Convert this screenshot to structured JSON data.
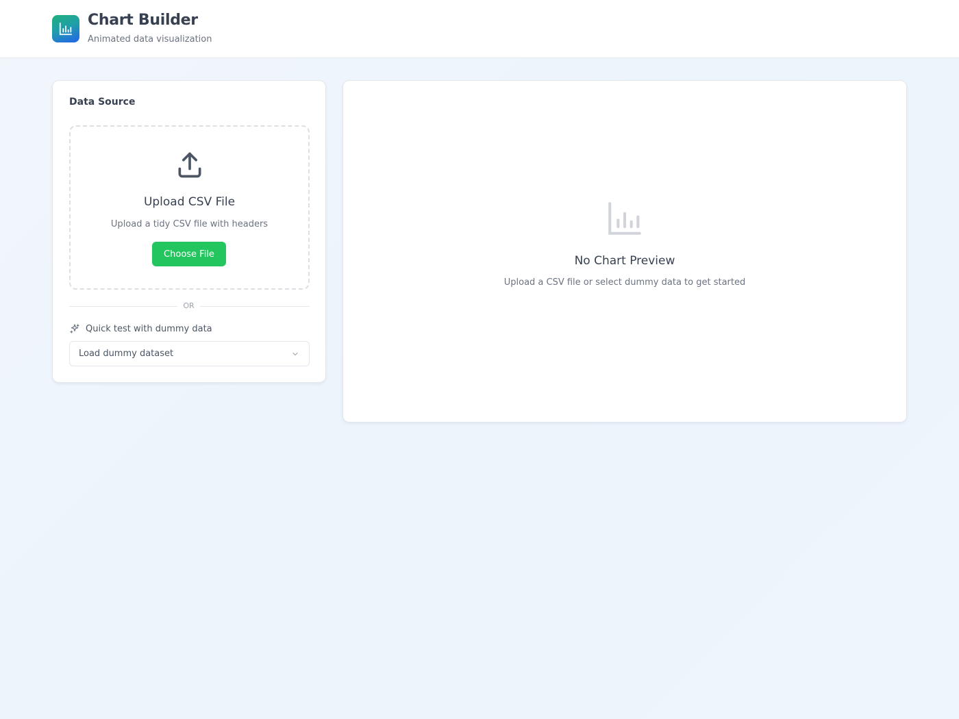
{
  "header": {
    "title": "Chart Builder",
    "subtitle": "Animated data visualization",
    "logo_icon": "bar-chart-icon"
  },
  "data_source": {
    "title": "Data Source",
    "upload": {
      "icon": "upload-icon",
      "title": "Upload CSV File",
      "hint": "Upload a tidy CSV file with headers",
      "button_label": "Choose File"
    },
    "divider_text": "OR",
    "quick_test": {
      "icon": "sparkles-icon",
      "label": "Quick test with dummy data"
    },
    "dummy_select": {
      "selected": "Load dummy dataset",
      "icon": "chevron-down-icon"
    }
  },
  "preview": {
    "icon": "bar-chart-icon",
    "title": "No Chart Preview",
    "hint": "Upload a CSV file or select dummy data to get started"
  },
  "colors": {
    "accent_green": "#22c55e",
    "logo_gradient_start": "#22b07d",
    "logo_gradient_end": "#2563eb",
    "page_background": "#eef5fc"
  }
}
